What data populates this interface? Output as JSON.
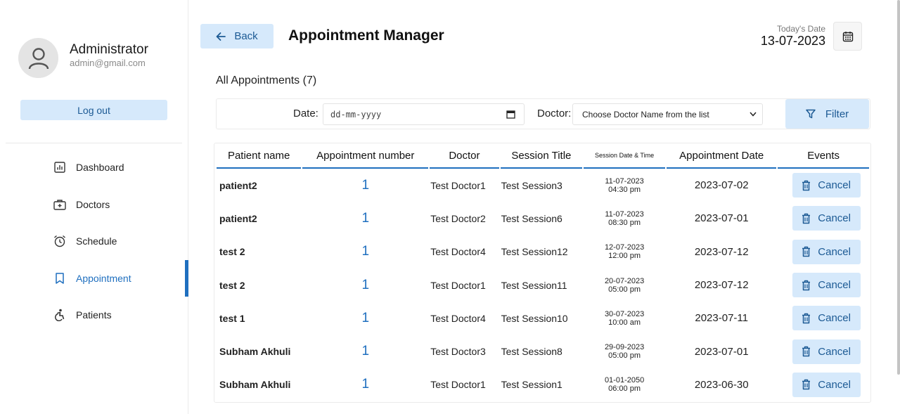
{
  "sidebar": {
    "profile_name": "Administrator",
    "profile_email": "admin@gmail.com",
    "logout_label": "Log out",
    "items": [
      {
        "label": "Dashboard",
        "icon": "dashboard-icon"
      },
      {
        "label": "Doctors",
        "icon": "medical-bag-icon"
      },
      {
        "label": "Schedule",
        "icon": "alarm-clock-icon"
      },
      {
        "label": "Appointment",
        "icon": "bookmark-icon",
        "active": true
      },
      {
        "label": "Patients",
        "icon": "accessibility-icon"
      }
    ]
  },
  "header": {
    "back_label": "Back",
    "title": "Appointment Manager",
    "today_label": "Today's Date",
    "today_value": "13-07-2023"
  },
  "summary": {
    "all_appointments": "All Appointments (7)"
  },
  "filter": {
    "date_label": "Date:",
    "date_placeholder": "dd-mm-yyyy",
    "doctor_label": "Doctor:",
    "doctor_selected": "Choose Doctor Name from the list",
    "filter_label": "Filter"
  },
  "table": {
    "headers": [
      "Patient name",
      "Appointment number",
      "Doctor",
      "Session Title",
      "Session Date & Time",
      "Appointment Date",
      "Events"
    ],
    "cancel_label": "Cancel",
    "rows": [
      {
        "patient": "patient2",
        "number": "1",
        "doctor": "Test Doctor1",
        "session": "Test Session3",
        "sdate": "11-07-2023",
        "stime": "04:30 pm",
        "adate": "2023-07-02"
      },
      {
        "patient": "patient2",
        "number": "1",
        "doctor": "Test Doctor2",
        "session": "Test Session6",
        "sdate": "11-07-2023",
        "stime": "08:30 pm",
        "adate": "2023-07-01"
      },
      {
        "patient": "test 2",
        "number": "1",
        "doctor": "Test Doctor4",
        "session": "Test Session12",
        "sdate": "12-07-2023",
        "stime": "12:00 pm",
        "adate": "2023-07-12"
      },
      {
        "patient": "test 2",
        "number": "1",
        "doctor": "Test Doctor1",
        "session": "Test Session11",
        "sdate": "20-07-2023",
        "stime": "05:00 pm",
        "adate": "2023-07-12"
      },
      {
        "patient": "test 1",
        "number": "1",
        "doctor": "Test Doctor4",
        "session": "Test Session10",
        "sdate": "30-07-2023",
        "stime": "10:00 am",
        "adate": "2023-07-11"
      },
      {
        "patient": "Subham Akhuli",
        "number": "1",
        "doctor": "Test Doctor3",
        "session": "Test Session8",
        "sdate": "29-09-2023",
        "stime": "05:00 pm",
        "adate": "2023-07-01"
      },
      {
        "patient": "Subham Akhuli",
        "number": "1",
        "doctor": "Test Doctor1",
        "session": "Test Session1",
        "sdate": "01-01-2050",
        "stime": "06:00 pm",
        "adate": "2023-06-30"
      }
    ]
  },
  "colors": {
    "accent": "#1f6fbf",
    "button_bg": "#d6e9fb",
    "button_text": "#1c5a94"
  }
}
